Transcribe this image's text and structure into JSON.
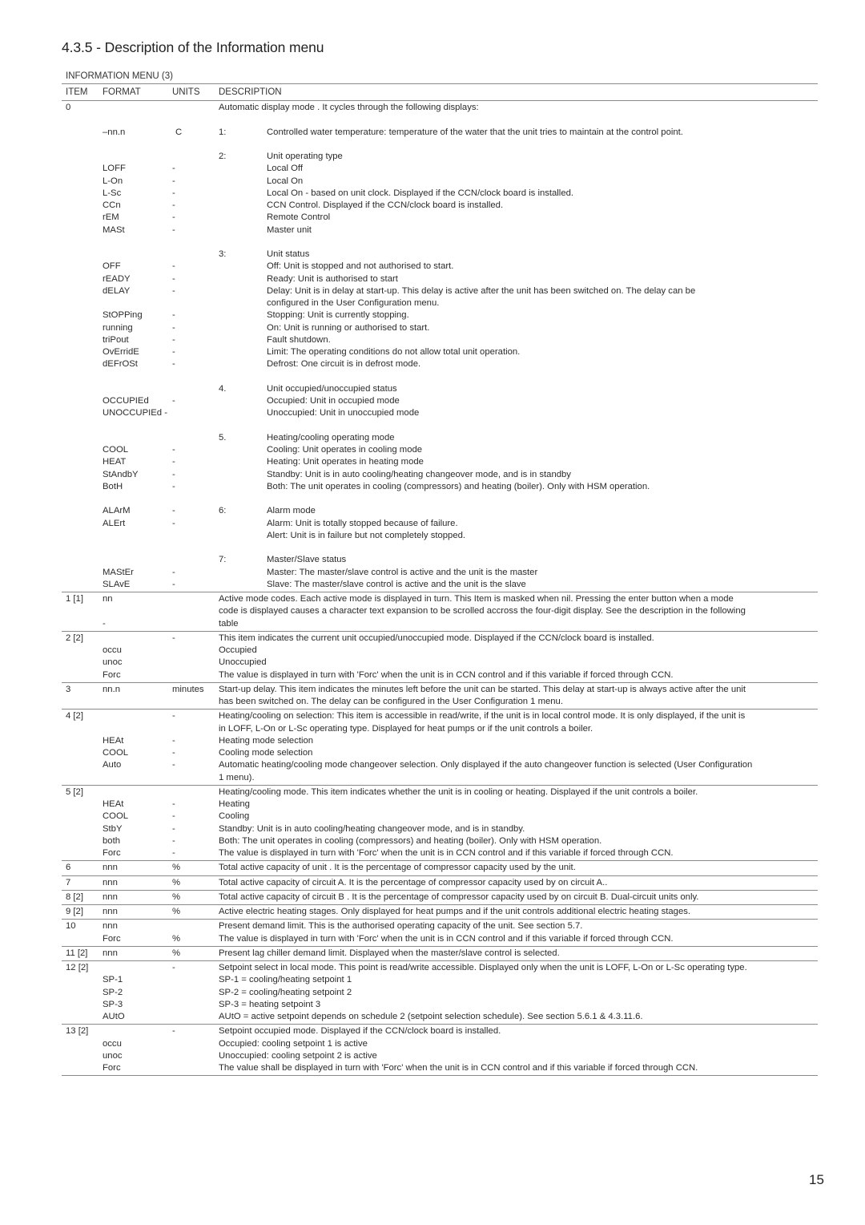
{
  "title": "4.3.5 - Description of the Information menu",
  "menu_label": "INFORMATION MENU (3)",
  "columns": {
    "item": "ITEM",
    "format": "FORMAT",
    "units": "UNITS",
    "description": "DESCRIPTION"
  },
  "item0": {
    "item": "0",
    "intro": "Automatic display  mode   . It cycles through the following displays:",
    "d1": {
      "num": "1:",
      "format": "–nn.n",
      "units": "C",
      "text": "Controlled water temperature:     temperature of the water that the unit tries to maintain at the control point."
    },
    "d2": {
      "num": "2:",
      "heading": "Unit operating type",
      "rows": [
        {
          "format": "LOFF",
          "units": "-",
          "text": "Local Off"
        },
        {
          "format": "L-On",
          "units": "-",
          "text": "Local On"
        },
        {
          "format": "L-Sc",
          "units": "-",
          "text": "Local On - based on unit clock. Displayed if the CCN/clock board is installed."
        },
        {
          "format": "CCn",
          "units": "-",
          "text": "CCN Control. Displayed if the CCN/clock board is installed."
        },
        {
          "format": "rEM",
          "units": "-",
          "text": "Remote Control"
        },
        {
          "format": "MASt",
          "units": "-",
          "text": "Master unit"
        }
      ]
    },
    "d3": {
      "num": "3:",
      "heading": "Unit status",
      "rows": [
        {
          "format": "OFF",
          "units": "-",
          "text": "Off: Unit is stopped and not authorised to start."
        },
        {
          "format": "rEADY",
          "units": "-",
          "text": "Ready: Unit is authorised to start"
        },
        {
          "format": "dELAY",
          "units": "-",
          "text": "Delay: Unit is in delay at start-up. This delay is active after the unit has been switched on. The delay can be",
          "text2": "configured in the User Configuration menu."
        },
        {
          "format": "StOPPing",
          "units": "-",
          "text": "Stopping: Unit is currently stopping."
        },
        {
          "format": "running",
          "units": "-",
          "text": "On: Unit is running or authorised to start."
        },
        {
          "format": "triPout",
          "units": "-",
          "text": "Fault shutdown."
        },
        {
          "format": "OvErridE",
          "units": "-",
          "text": "Limit: The operating conditions do not allow total unit operation."
        },
        {
          "format": "dEFrOSt",
          "units": "-",
          "text": "Defrost: One circuit is in defrost mode."
        }
      ]
    },
    "d4": {
      "num": "4.",
      "heading": "Unit occupied/unoccupied status",
      "rows": [
        {
          "format": "OCCUPIEd",
          "units": "-",
          "text": "Occupied: Unit in occupied mode"
        },
        {
          "format": "UNOCCUPIEd -",
          "units": "",
          "text": "Unoccupied: Unit in unoccupied mode"
        }
      ]
    },
    "d5": {
      "num": "5.",
      "heading": "Heating/cooling operating mode",
      "rows": [
        {
          "format": "COOL",
          "units": "-",
          "text": "Cooling: Unit operates in cooling mode"
        },
        {
          "format": "HEAT",
          "units": "-",
          "text": "Heating: Unit operates in heating mode"
        },
        {
          "format": "StAndbY",
          "units": "-",
          "text": "Standby: Unit is in auto cooling/heating changeover mode, and is in standby"
        },
        {
          "format": "BotH",
          "units": "-",
          "text": "Both: The unit operates in cooling (compressors) and heating (boiler). Only with HSM operation."
        }
      ]
    },
    "d6": {
      "num": "6:",
      "heading": "Alarm mode",
      "rows": [
        {
          "format": "ALArM",
          "units": "-",
          "text": "Alarm: Unit is totally stopped because of failure."
        },
        {
          "format": "ALErt",
          "units": "-",
          "text": "Alert: Unit is in failure but not completely stopped."
        }
      ]
    },
    "d7": {
      "num": "7:",
      "heading": "Master/Slave status",
      "rows": [
        {
          "format": "MAStEr",
          "units": "-",
          "text": "Master: The master/slave control is active and the unit is the master"
        },
        {
          "format": "SLAvE",
          "units": "-",
          "text": "Slave: The master/slave control is active and the unit is the slave"
        }
      ]
    }
  },
  "items": {
    "i1": {
      "item": "1 [1]",
      "format": "nn",
      "format2": "-",
      "lines": [
        "Active mode codes.    Each active mode is displayed in turn. This Item is masked when nil. Pressing the enter button when a mode",
        "code is displayed causes a character text expansion to be scrolled accross the four-digit  display. See the description in the following",
        "table"
      ]
    },
    "i2": {
      "item": "2 [2]",
      "units": "-",
      "desc": "This item indicates the current unit occupied/unoccupied     mode. Displayed if the CCN/clock board is installed.",
      "rows": [
        {
          "format": "occu",
          "text": "Occupied"
        },
        {
          "format": "unoc",
          "text": "Unoccupied"
        },
        {
          "format": "Forc",
          "text": "The value is displayed in turn with 'Forc' when the unit is in CCN control and if this variable if forced through CCN."
        }
      ]
    },
    "i3": {
      "item": "3",
      "format": "nn.n",
      "units": "minutes",
      "lines": [
        "Start-up delay.   This item indicates the minutes left before the unit can be started. This delay at start-up is always active  after the unit",
        "has been switched on. The delay can be configured in the User Configuration 1 menu."
      ]
    },
    "i4": {
      "item": "4 [2]",
      "units": "-",
      "lines": [
        "Heating/cooling on selection:     This item is accessible in read/write, if the unit is in local control mode. It is only displayed, if the unit is",
        "in LOFF, L-On or L-Sc operating type. Displayed for heat pumps or if the unit controls a boiler."
      ],
      "rows": [
        {
          "format": "HEAt",
          "units": "-",
          "text": "Heating mode selection"
        },
        {
          "format": "COOL",
          "units": "-",
          "text": "Cooling mode selection"
        },
        {
          "format": "Auto",
          "units": "-",
          "text": "Automatic heating/cooling mode changeover selection. Only displayed if the auto changeover function is selected (User Configuration",
          "text2": "1 menu)."
        }
      ]
    },
    "i5": {
      "item": "5 [2]",
      "desc": "Heating/cooling mode.    This item indicates whether the unit is in cooling or heating. Displayed if the unit controls a boiler.",
      "rows": [
        {
          "format": "HEAt",
          "units": "-",
          "text": "Heating"
        },
        {
          "format": "COOL",
          "units": "-",
          "text": "Cooling"
        },
        {
          "format": "StbY",
          "units": "-",
          "text": "Standby: Unit is in auto cooling/heating changeover mode, and is in standby."
        },
        {
          "format": "both",
          "units": "-",
          "text": "Both: The unit operates in cooling (compressors) and heating (boiler). Only with HSM operation."
        },
        {
          "format": "Forc",
          "units": "-",
          "text": "The value is displayed in turn with 'Forc' when the unit is in CCN control and if this variable if forced through CCN."
        }
      ]
    },
    "i6": {
      "item": "6",
      "format": "nnn",
      "units": "%",
      "desc": "Total active capacity of unit    . It is the percentage of compressor capacity used by the unit."
    },
    "i7": {
      "item": "7",
      "format": "nnn",
      "units": "%",
      "desc": "Total active capacity of circuit A.     It is the percentage of compressor capacity used by on circuit A.."
    },
    "i8": {
      "item": "8 [2]",
      "format": "nnn",
      "units": "%",
      "desc": "Total active capacity of circuit B    . It is the percentage of compressor capacity used by on circuit B. Dual-circuit units only."
    },
    "i9": {
      "item": "9 [2]",
      "format": "nnn",
      "units": "%",
      "desc": "Active electric heating stages.     Only displayed for heat pumps and if the unit controls additional electric heating stages."
    },
    "i10": {
      "item": "10",
      "format": "nnn",
      "desc": "Present demand limit.    This is the authorised operating capacity of the unit. See section 5.7.",
      "format2": "Forc",
      "units2": "%",
      "desc2": "The value is displayed in turn with 'Forc' when the unit is in CCN control and if this variable if forced through CCN."
    },
    "i11": {
      "item": "11 [2]",
      "format": "nnn",
      "units": "%",
      "desc": "Present lag chiller demand limit.     Displayed when the master/slave control is selected."
    },
    "i12": {
      "item": "12 [2]",
      "units": "-",
      "desc": "Setpoint select in local mode.     This point is read/write accessible. Displayed only when the unit is LOFF, L-On or L-Sc operating type.",
      "rows": [
        {
          "format": "SP-1",
          "text": "SP-1 = cooling/heating setpoint 1"
        },
        {
          "format": "SP-2",
          "text": "SP-2 = cooling/heating setpoint 2"
        },
        {
          "format": "SP-3",
          "text": "SP-3 = heating setpoint 3"
        },
        {
          "format": "AUtO",
          "text": "AUtO = active setpoint depends on schedule 2 (setpoint selection schedule). See section 5.6.1 & 4.3.11.6."
        }
      ]
    },
    "i13": {
      "item": "13 [2]",
      "units": "-",
      "desc": "Setpoint occupied mode.    Displayed if the CCN/clock board is installed.",
      "rows": [
        {
          "format": "occu",
          "text": "Occupied: cooling setpoint 1 is active"
        },
        {
          "format": "unoc",
          "text": "Unoccupied: cooling setpoint 2 is active"
        },
        {
          "format": "Forc",
          "text": "The value shall be displayed in turn with 'Forc' when the unit is in CCN control and if this variable if forced through CCN."
        }
      ]
    }
  },
  "page_number": "15"
}
